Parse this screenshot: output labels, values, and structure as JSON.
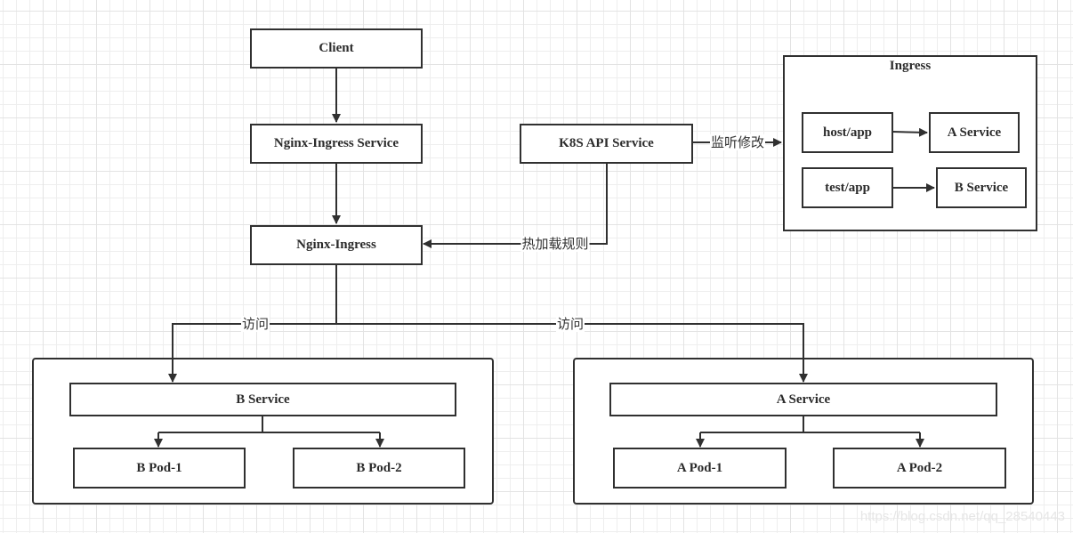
{
  "nodes": {
    "client": "Client",
    "nginx_ingress_service": "Nginx-Ingress Service",
    "nginx_ingress": "Nginx-Ingress",
    "k8s_api_service": "K8S API Service"
  },
  "ingress_group": {
    "title": "Ingress",
    "rules": [
      {
        "path": "host/app",
        "target": "A Service"
      },
      {
        "path": "test/app",
        "target": "B Service"
      }
    ]
  },
  "edge_labels": {
    "watch_changes": "监听修改",
    "hot_reload_rules": "热加载规则",
    "access_left": "访问",
    "access_right": "访问"
  },
  "clusters": {
    "b": {
      "service": "B Service",
      "pods": [
        "B Pod-1",
        "B Pod-2"
      ]
    },
    "a": {
      "service": "A Service",
      "pods": [
        "A Pod-1",
        "A Pod-2"
      ]
    }
  },
  "watermark": "https://blog.csdn.net/qq_28540443"
}
